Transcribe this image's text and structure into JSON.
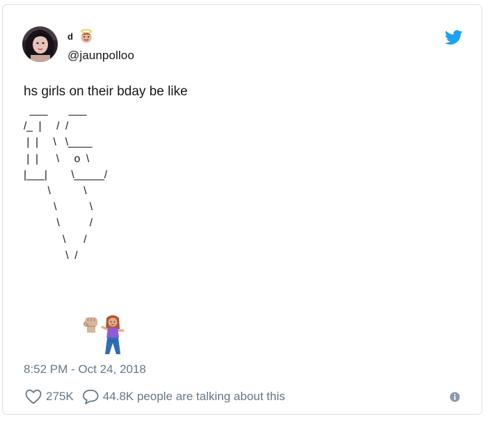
{
  "tweet": {
    "author": {
      "display_name": "d",
      "name_emoji": "angel-face-emoji",
      "handle": "@jaunpolloo",
      "avatar": "profile-photo-avatar"
    },
    "text": "hs girls on their bday be like",
    "ascii_art": "  ___       ___\n/_  |     /  /\n |  |     \\   \\____\n |  |      \\     o  \\\n|___|        \\_____/\n        \\           \\\n          \\           \\\n           \\          /\n             \\      /\n              \\  /",
    "art_emojis": [
      "raised-fist-emoji",
      "woman-dancing-pose-emoji"
    ],
    "timestamp": "8:52 PM - Oct 24, 2018",
    "likes": "275K",
    "replies_text": "44.8K people are talking about this",
    "icons": {
      "like": "heart-icon",
      "reply": "speech-bubble-icon",
      "info": "info-icon",
      "brand": "twitter-bird-icon"
    }
  },
  "colors": {
    "text": "#14171a",
    "muted": "#657786",
    "twitter_blue": "#1da1f2",
    "border": "#dcdfe2"
  }
}
